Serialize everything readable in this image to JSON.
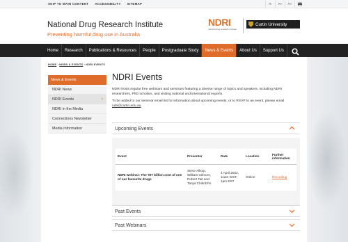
{
  "utility": {
    "skip": "SKIP TO MAIN CONTENT",
    "accessibility": "ACCESSIBILITY",
    "sitemap": "SITEMAP",
    "text_small": "A-",
    "text_normal": "A+",
    "text_large": "A+",
    "print_icon": "print-icon"
  },
  "header": {
    "title": "National Drug Research Institute",
    "tagline": "Preventing harmful drug use in Australia",
    "ndri_logo": "NDRI",
    "ndri_sub": "national drug research institute",
    "curtin": "Curtin University"
  },
  "nav": {
    "items": [
      "Home",
      "Research",
      "Publications & Resources",
      "People",
      "Postgraduate Study",
      "News & Events",
      "About Us",
      "Support Us"
    ],
    "active": "News & Events",
    "search_icon": "search-icon"
  },
  "breadcrumb": {
    "home": "HOME",
    "sep": "›",
    "news": "NEWS & EVENTS",
    "current": "NDRI EVENTS"
  },
  "sidenav": {
    "head": "News & Events",
    "items": [
      "NDRI News",
      "NDRI Events",
      "NDRI in the Media",
      "Connections Newsletter",
      "Media Information"
    ]
  },
  "main": {
    "title": "NDRI Events",
    "intro": "NDRI hosts regular free webinars and seminars featuring a diverse range of topics and speakers, including NDRI researchers, PhD scholars, and visiting national and international experts.",
    "email_prefix": "To be added to our seminar email list for information about upcoming events, or to RSVP to an event, please email ",
    "email": "ndri@curtin.edu.au",
    "email_suffix": "."
  },
  "accordions": {
    "upcoming": "Upcoming Events",
    "past_events": "Past Events",
    "past_webinars": "Past Webinars"
  },
  "table": {
    "headers": {
      "event": "Event",
      "presenter": "Presenter",
      "date": "Date",
      "location": "Location",
      "further": "Further information"
    },
    "rows": [
      {
        "event": "NDRI webinar: The 'MT billion cost of one of our favourite drugs",
        "presenter": "Steve Allsop, William Gilmore, Robert Tait and Tanya Chikritzhs",
        "date": "4 April 2022, 11am WST, 1pm EST",
        "location": "Online",
        "link": "Recording"
      }
    ]
  },
  "colors": {
    "accent": "#e06c2b",
    "nav": "#222222"
  }
}
